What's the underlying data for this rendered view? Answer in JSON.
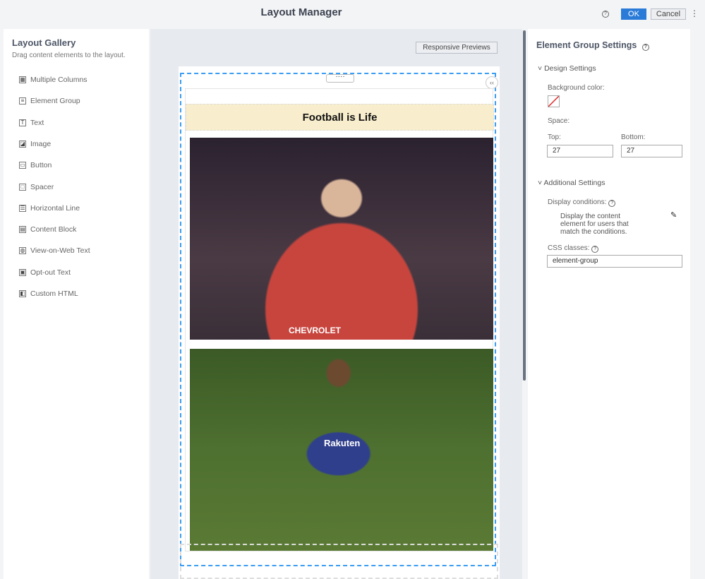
{
  "header": {
    "title": "Layout Manager",
    "ok": "OK",
    "cancel": "Cancel",
    "help": "?",
    "more": "⋮"
  },
  "gallery": {
    "title": "Layout Gallery",
    "subtitle": "Drag content elements to the layout.",
    "items": [
      {
        "label": "Multiple Columns",
        "icon": "▦"
      },
      {
        "label": "Element Group",
        "icon": "≡"
      },
      {
        "label": "Text",
        "icon": "T"
      },
      {
        "label": "Image",
        "icon": "◪"
      },
      {
        "label": "Button",
        "icon": "▭"
      },
      {
        "label": "Spacer",
        "icon": "□"
      },
      {
        "label": "Horizontal Line",
        "icon": "☰"
      },
      {
        "label": "Content Block",
        "icon": "▤"
      },
      {
        "label": "View-on-Web Text",
        "icon": "◍"
      },
      {
        "label": "Opt-out Text",
        "icon": "▣"
      },
      {
        "label": "Custom HTML",
        "icon": "◧"
      }
    ]
  },
  "canvas": {
    "responsive_previews": "Responsive Previews",
    "handle": "····",
    "collapse": "‹‹",
    "banner": "Football is Life",
    "images": [
      {
        "alt_text": "CHEVROLET"
      },
      {
        "alt_text": "Rakuten"
      }
    ]
  },
  "settings": {
    "title": "Element Group Settings",
    "design_section": "Design Settings",
    "background_label": "Background color:",
    "space_label": "Space:",
    "top_label": "Top:",
    "top_value": "27",
    "bottom_label": "Bottom:",
    "bottom_value": "27",
    "additional_section": "Additional Settings",
    "display_conditions_label": "Display conditions:",
    "display_conditions_text": "Display the content element for users that match the conditions.",
    "css_label": "CSS classes:",
    "css_value": "element-group"
  }
}
